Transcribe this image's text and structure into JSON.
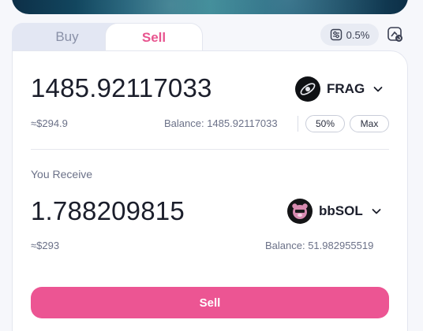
{
  "tabs": {
    "buy_label": "Buy",
    "sell_label": "Sell",
    "active": "Sell"
  },
  "settings": {
    "slippage": "0.5%"
  },
  "pay": {
    "amount": "1485.92117033",
    "token": "FRAG",
    "usd_value": "≈$294.9",
    "balance": "Balance: 1485.92117033",
    "pct_50_label": "50%",
    "max_label": "Max"
  },
  "receive": {
    "label": "You Receive",
    "amount": "1.788209815",
    "token": "bbSOL",
    "usd_value": "≈$293",
    "balance": "Balance: 51.982955519"
  },
  "action": {
    "button_label": "Sell"
  },
  "colors": {
    "accent": "#ec5593",
    "tab_sell_text": "#e8558f",
    "muted": "#6b7188"
  },
  "icons": [
    "sliders-icon",
    "refresh-icon",
    "frag-logo-icon",
    "chevron-down-icon",
    "bbsol-logo-icon"
  ]
}
